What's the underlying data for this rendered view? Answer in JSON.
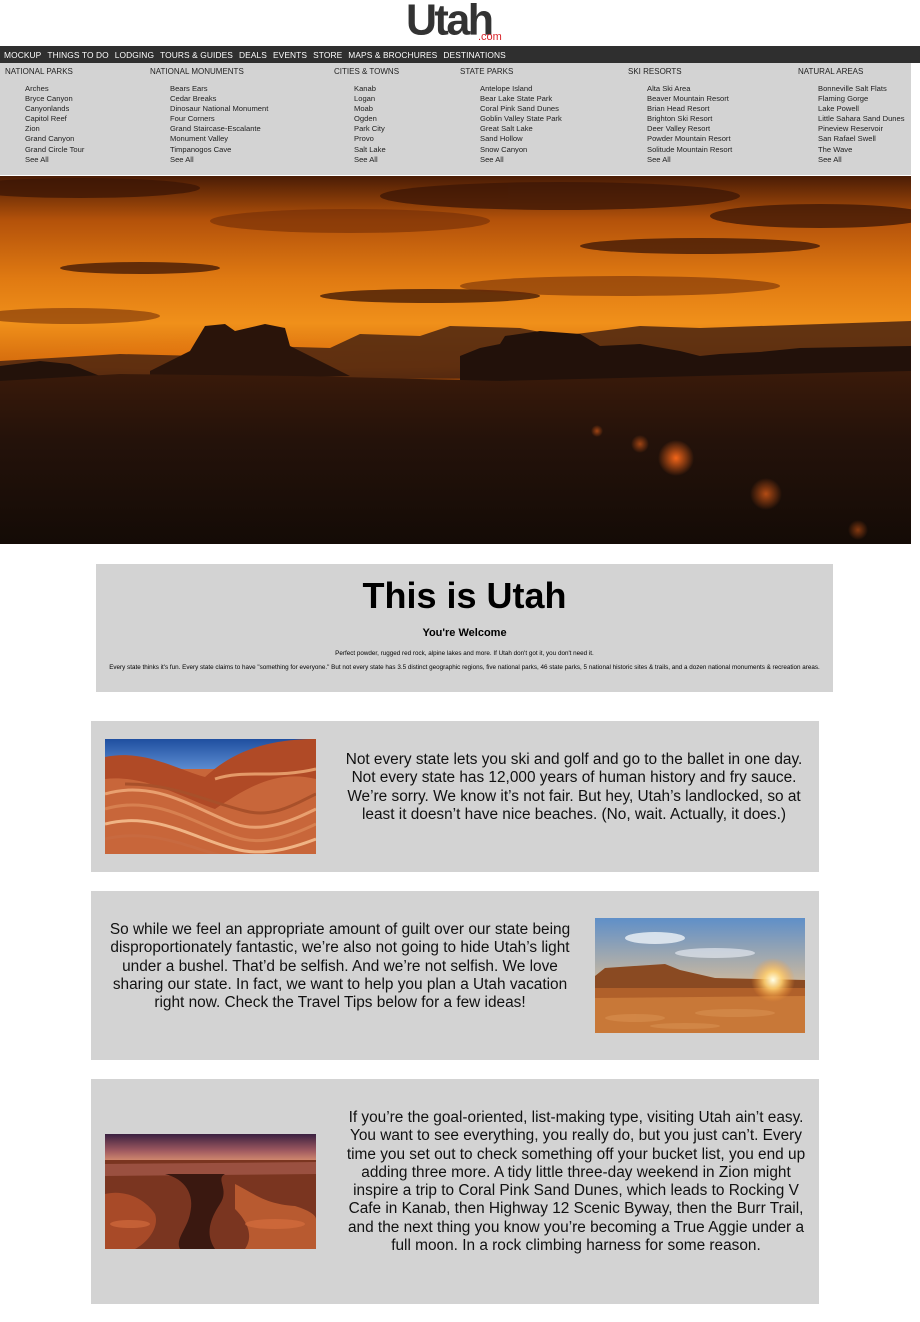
{
  "logo": {
    "main": "Utah",
    "sub": ".com"
  },
  "nav": [
    "MOCKUP",
    "THINGS TO DO",
    "LODGING",
    "TOURS & GUIDES",
    "DEALS",
    "EVENTS",
    "STORE",
    "MAPS & BROCHURES",
    "DESTINATIONS"
  ],
  "menu": [
    {
      "title": "NATIONAL PARKS",
      "items": [
        "Arches",
        "Bryce Canyon",
        "Canyonlands",
        "Capitol Reef",
        "Zion",
        "Grand Canyon",
        "Grand Circle Tour",
        "See All"
      ]
    },
    {
      "title": "NATIONAL MONUMENTS",
      "items": [
        "Bears Ears",
        "Cedar Breaks",
        "Dinosaur National Monument",
        "Four Corners",
        "Grand Staircase-Escalante",
        "Monument Valley",
        "Timpanogos Cave",
        "See All"
      ]
    },
    {
      "title": "CITIES & TOWNS",
      "items": [
        "Kanab",
        "Logan",
        "Moab",
        "Ogden",
        "Park City",
        "Provo",
        "Salt Lake",
        "See All"
      ]
    },
    {
      "title": "STATE PARKS",
      "items": [
        "Antelope Island",
        "Bear Lake State Park",
        "Coral Pink Sand Dunes",
        "Goblin Valley State Park",
        "Great Salt Lake",
        "Sand Hollow",
        "Snow Canyon",
        "See All"
      ]
    },
    {
      "title": "SKI RESORTS",
      "items": [
        "Alta Ski Area",
        "Beaver Mountain Resort",
        "Brian Head Resort",
        "Brighton Ski Resort",
        "Deer Valley Resort",
        "Powder Mountain Resort",
        "Solitude Mountain Resort",
        "See All"
      ]
    },
    {
      "title": "NATURAL AREAS",
      "items": [
        "Bonneville Salt Flats",
        "Flaming Gorge",
        "Lake Powell",
        "Little Sahara Sand Dunes",
        "Pineview Reservoir",
        "San Rafael Swell",
        "The Wave",
        "See All"
      ]
    }
  ],
  "intro": {
    "title": "This is Utah",
    "subtitle": "You're Welcome",
    "line1": "Perfect powder, rugged red rock, alpine lakes and more. If Utah don't got it, you don't need it.",
    "line2": "Every state thinks it's fun. Every state claims to have \"something for everyone.\" But not every state has 3.5 distinct geographic regions, five national parks, 46 state parks, 5 national historic sites & trails, and a dozen national monuments & recreation areas."
  },
  "cards": [
    {
      "text": "Not every state lets you ski and golf and go to the ballet in one day. Not every state has 12,000 years of human history and fry sauce. We’re sorry. We know it’s not fair. But hey, Utah’s landlocked, so at least it doesn’t have nice beaches. (No, wait. Actually, it does.)"
    },
    {
      "text": "So while we feel an appropriate amount of guilt over our state being disproportionately fantastic, we’re also not going to hide Utah’s light under a bushel. That’d be selfish. And we’re not selfish. We love sharing our state. In fact, we want to help you plan a Utah vacation right now. Check the Travel Tips below for a few ideas!"
    },
    {
      "text": "If you’re the goal-oriented, list-making type, visiting Utah ain’t easy. You want to see everything, you really do, but you just can’t. Every time you set out to check something off your bucket list, you end up adding three more. A tidy little three-day weekend in Zion might inspire a trip to Coral Pink Sand Dunes, which leads to Rocking V Cafe in Kanab, then Highway 12 Scenic Byway, then the Burr Trail, and the next thing you know you’re becoming a True Aggie under a full moon. In a rock climbing harness for some reason."
    }
  ]
}
